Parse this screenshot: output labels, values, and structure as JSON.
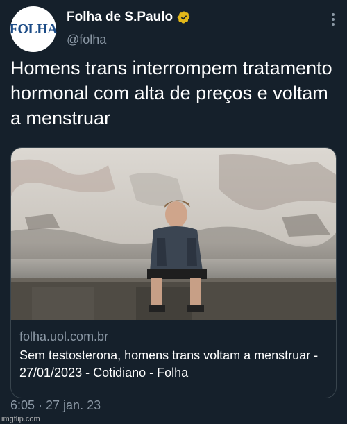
{
  "account": {
    "avatar_text": "FOLHA",
    "display_name": "Folha de S.Paulo",
    "handle": "@folha",
    "verified_icon": "verified-badge-icon"
  },
  "tweet": {
    "text": "Homens trans interrompem tratamento hormonal com alta de preços e voltam a menstruar",
    "timestamp": "6:05 · 27 jan. 23"
  },
  "link_card": {
    "domain": "folha.uol.com.br",
    "title": "Sem testosterona, homens trans voltam a menstruar - 27/01/2023 - Cotidiano - Folha"
  },
  "watermark": "imgflip.com",
  "colors": {
    "background": "#15202b",
    "secondary_text": "#8b98a5",
    "verified": "#e2b719",
    "border": "#38444d"
  }
}
